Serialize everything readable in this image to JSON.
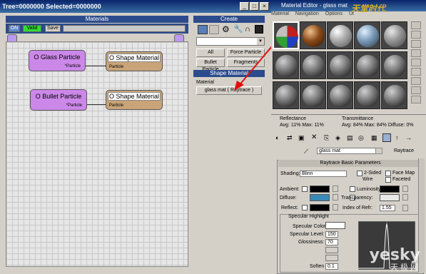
{
  "left_window": {
    "title": "Tree=0000000  Selected=0000000",
    "buttons": [
      "_",
      "□",
      "×"
    ]
  },
  "materials_panel": {
    "header": "Materials",
    "toolbar": {
      "on": "ON",
      "valid": "Valid",
      "save": "Save"
    },
    "nodes": [
      {
        "title": "O Glass Particle",
        "sub": "*Particle",
        "color": "#cc88e8"
      },
      {
        "title": "O Shape Material",
        "sub": "Particle",
        "color": "#c8a478"
      },
      {
        "title": "O Bullet Particle",
        "sub": "*Particle",
        "color": "#cc88e8"
      },
      {
        "title": "O Shape Material",
        "sub": "Particle",
        "color": "#c8a478"
      }
    ]
  },
  "create_panel": {
    "header": "Create",
    "buttons": [
      "All",
      "Force Particle",
      "Bullet Particle",
      "Fragments"
    ],
    "shape_header": "Shape Material",
    "material_label": "Material",
    "material_value": "glass mat  ( Raytrace )"
  },
  "material_editor": {
    "title": "Material Editor - glass mat",
    "menu": [
      "Material",
      "Navigation",
      "Options",
      "Ut"
    ],
    "reflectance_label": "Reflectance",
    "reflectance_values": "Avg:  11% Max:  11%",
    "transmittance_label": "Transmittance",
    "transmittance_values": "Avg:  84% Max:  84%  Diffuse:  0%",
    "material_name": "glass mat",
    "material_type": "Raytrace",
    "rollout_title": "Raytrace Basic Parameters",
    "shading_label": "Shading:",
    "shading_value": "Blinn",
    "options": {
      "two_sided": "2-Sided",
      "face_map": "Face Map",
      "wire": "Wire",
      "faceted": "Faceted"
    },
    "ambient_label": "Ambient:",
    "diffuse_label": "Diffuse:",
    "reflect_label": "Reflect:",
    "luminosity_label": "Luminosity:",
    "transparency_label": "Transparency:",
    "ior_label": "Index of Refr:",
    "ior_value": "1.55",
    "specular_header": "Specular Highlight",
    "spec_color_label": "Specular Color",
    "spec_level_label": "Specular Level:",
    "spec_level_value": "150",
    "glossiness_label": "Glossiness:",
    "glossiness_value": "70",
    "soften_label": "Soften",
    "soften_value": "0.1",
    "colors": {
      "ambient": "#000000",
      "diffuse": "#3a8ab8",
      "reflect": "#000000",
      "luminosity": "#000000",
      "transparency": "#e8e8e8",
      "specular": "#ffffff"
    }
  },
  "watermark": {
    "text": "yesky",
    "sub": "天极网",
    "logo": "天堂时代"
  }
}
